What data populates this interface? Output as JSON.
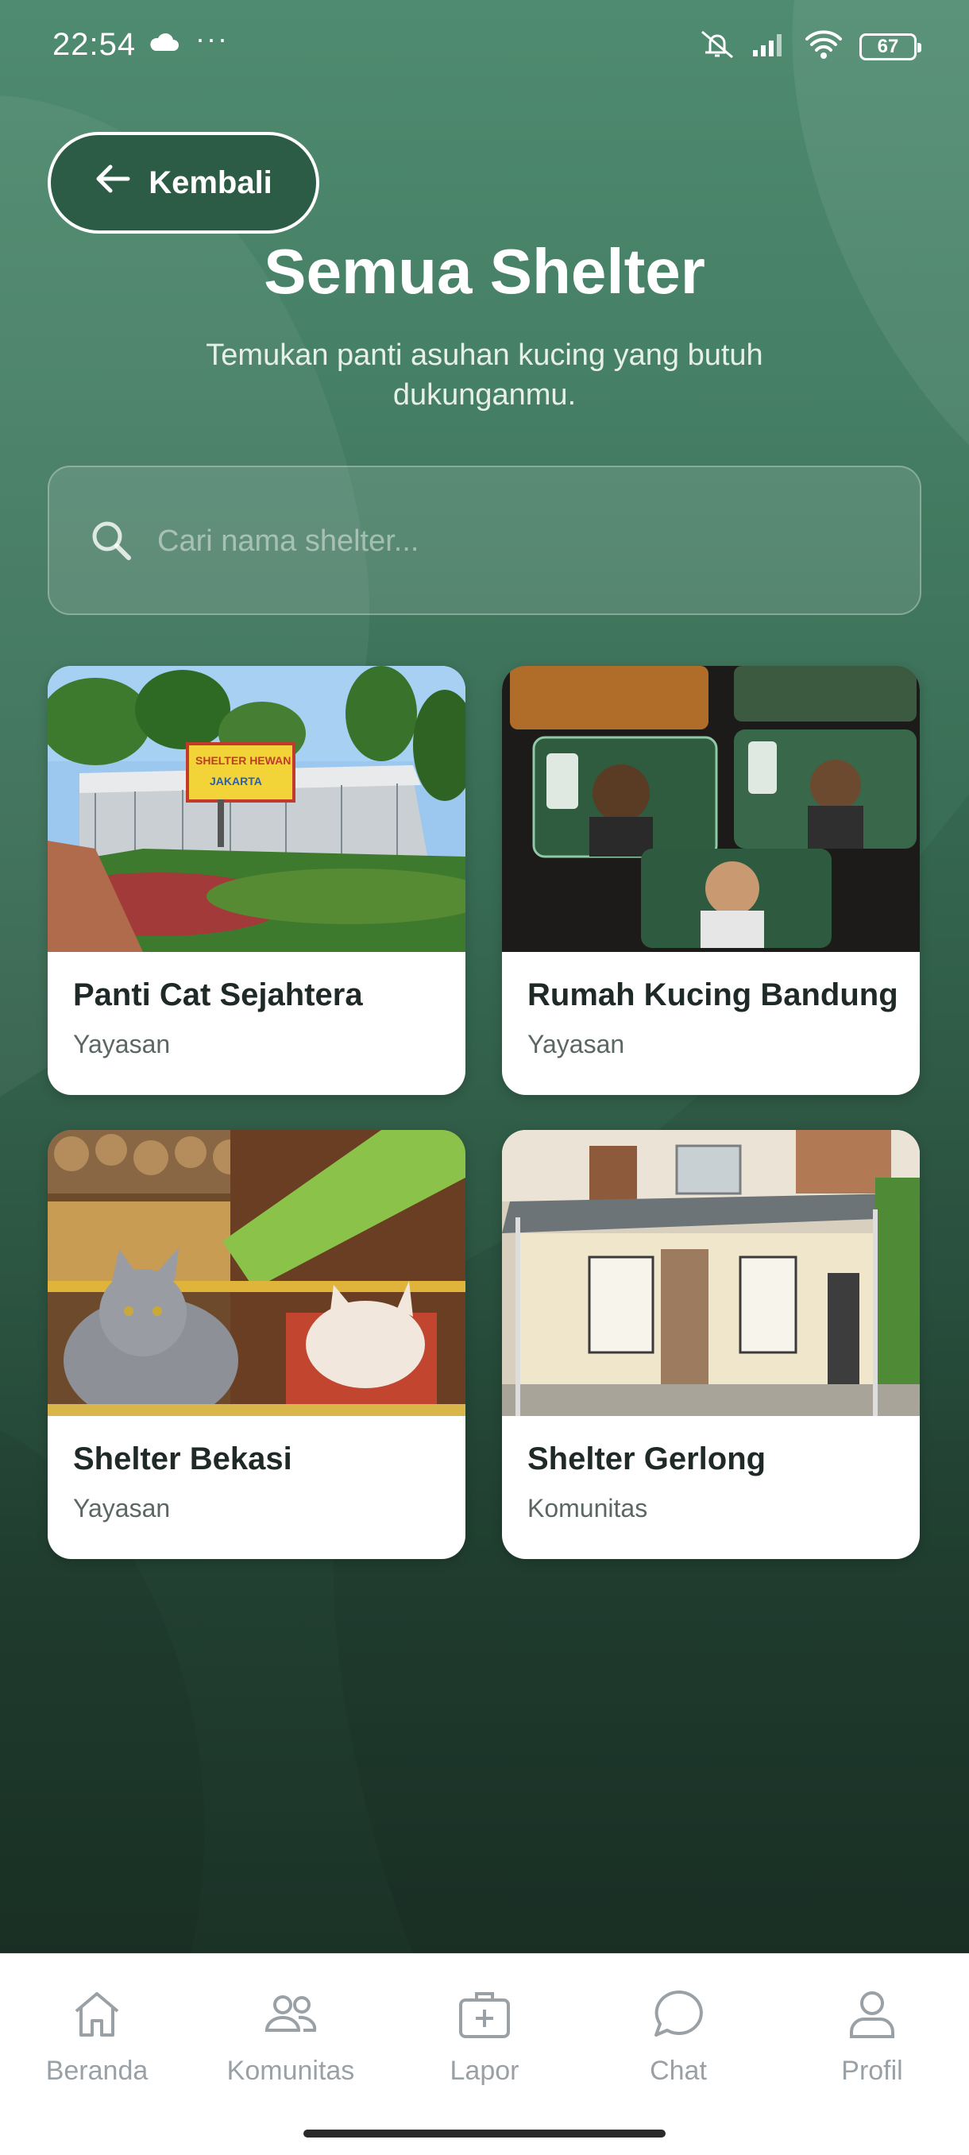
{
  "status_bar": {
    "time": "22:54",
    "dots": "···",
    "battery": "67"
  },
  "header": {
    "back_label": "Kembali",
    "title": "Semua Shelter",
    "subtitle": "Temukan panti asuhan kucing yang butuh dukunganmu."
  },
  "search": {
    "placeholder": "Cari nama shelter...",
    "value": ""
  },
  "shelters": [
    {
      "name": "Panti Cat Sejahtera",
      "type": "Yayasan",
      "sign_text_1": "SHELTER HEWAN",
      "sign_text_2": "JAKARTA"
    },
    {
      "name": "Rumah Kucing Bandung",
      "type": "Yayasan"
    },
    {
      "name": "Shelter Bekasi",
      "type": "Yayasan"
    },
    {
      "name": "Shelter Gerlong",
      "type": "Komunitas"
    }
  ],
  "bottom_nav": {
    "items": [
      {
        "label": "Beranda",
        "icon": "home-icon"
      },
      {
        "label": "Komunitas",
        "icon": "people-icon"
      },
      {
        "label": "Lapor",
        "icon": "report-icon"
      },
      {
        "label": "Chat",
        "icon": "chat-icon"
      },
      {
        "label": "Profil",
        "icon": "profile-icon"
      }
    ]
  },
  "colors": {
    "accent": "#2c5c46",
    "background_top": "#4f8b70",
    "background_bottom": "#1b3227",
    "nav_inactive": "#9aa1a6"
  }
}
